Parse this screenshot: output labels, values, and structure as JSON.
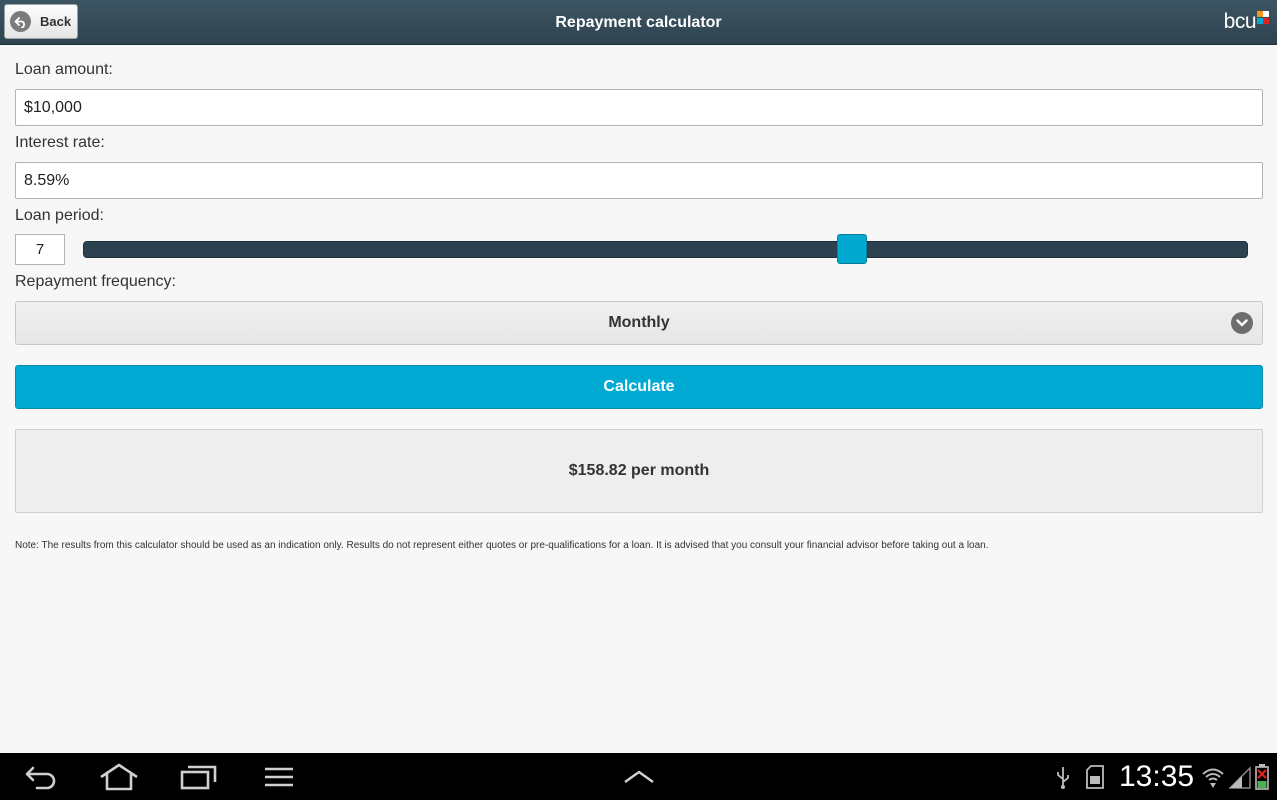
{
  "header": {
    "back_label": "Back",
    "title": "Repayment calculator",
    "brand_text": "bcu",
    "brand_colors": [
      "#f7941d",
      "#ffffff",
      "#00aad3",
      "#e2231a"
    ]
  },
  "form": {
    "loan_amount_label": "Loan amount:",
    "loan_amount_value": "$10,000",
    "interest_rate_label": "Interest rate:",
    "interest_rate_value": "8.59%",
    "loan_period_label": "Loan period:",
    "loan_period_value": "7",
    "loan_period_slider_fraction": 0.66,
    "repayment_frequency_label": "Repayment frequency:",
    "repayment_frequency_value": "Monthly",
    "calculate_label": "Calculate"
  },
  "result": {
    "text": "$158.82 per month"
  },
  "note": "Note: The results from this calculator should be used as an indication only. Results do not represent either quotes or pre-qualifications for a loan. It is advised that you consult your financial advisor before taking out a loan.",
  "system_bar": {
    "time": "13:35",
    "icons": [
      "back-icon",
      "home-icon",
      "recent-apps-icon",
      "menu-icon",
      "up-arrow-icon",
      "usb-icon",
      "sd-card-icon",
      "wifi-icon",
      "signal-icon",
      "battery-icon"
    ]
  },
  "colors": {
    "accent": "#00aad3",
    "header": "#34495a",
    "slider_track": "#2c4250"
  }
}
